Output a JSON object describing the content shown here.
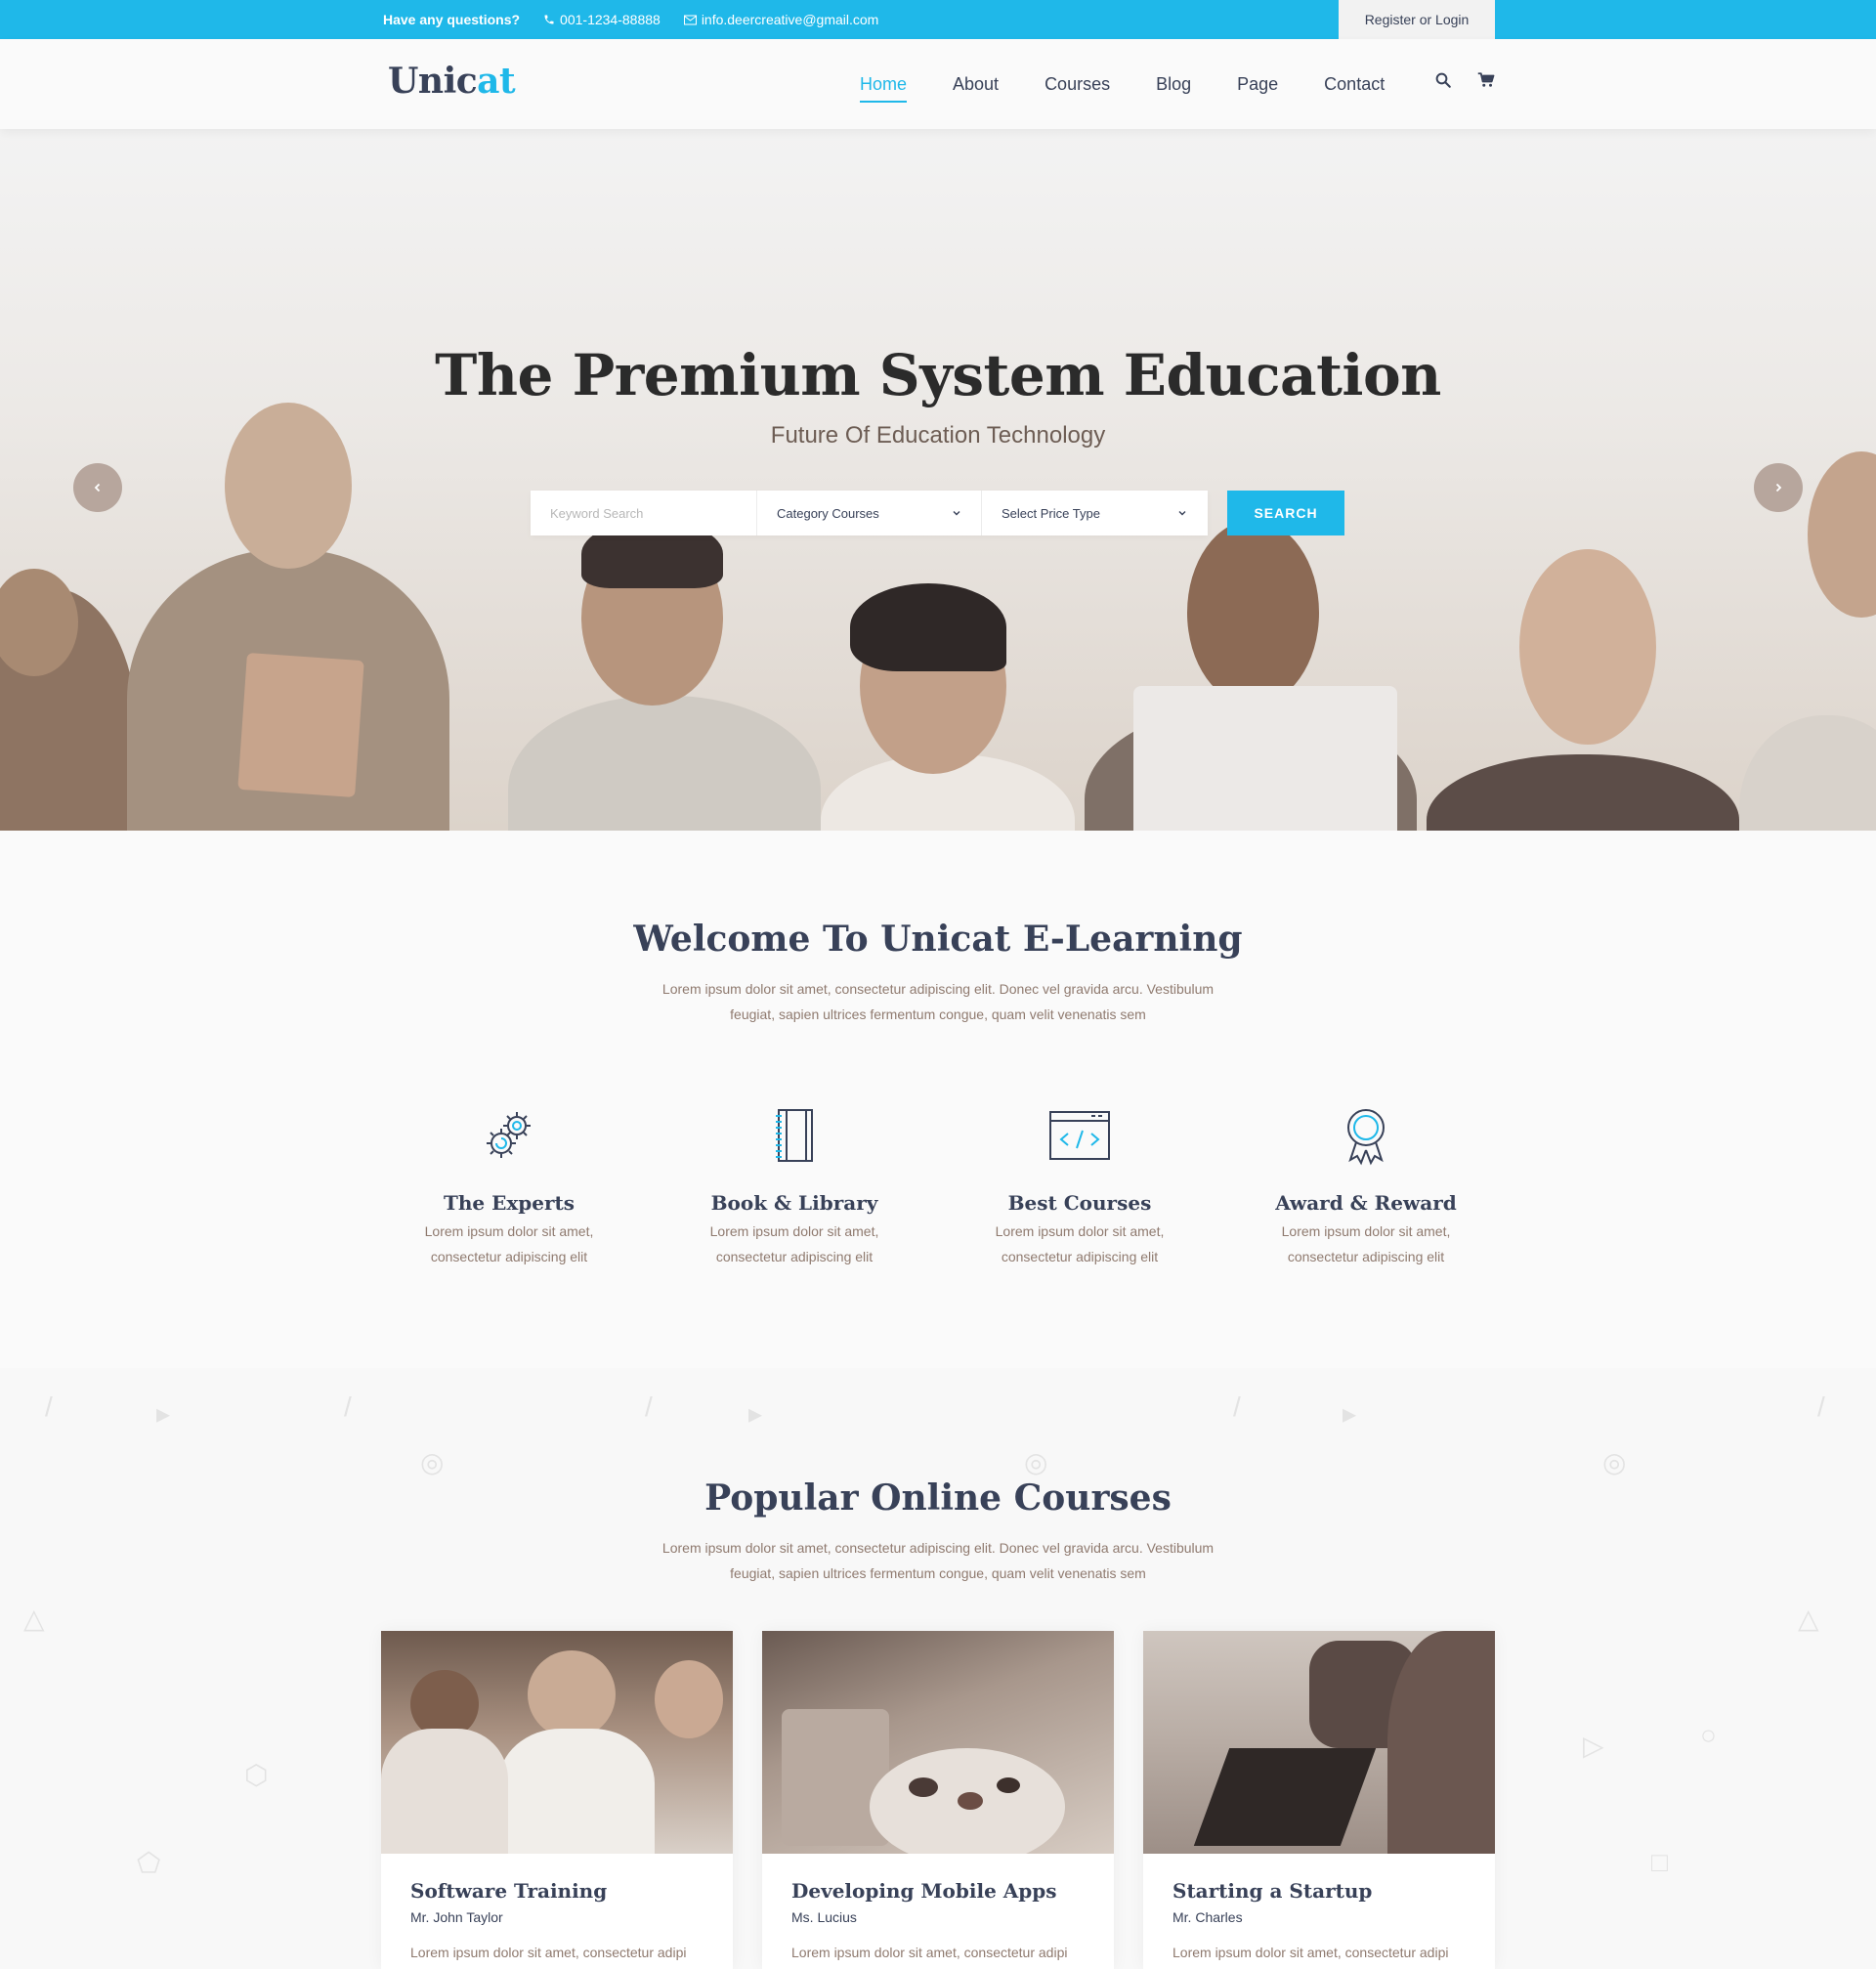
{
  "topbar": {
    "question": "Have any questions?",
    "phone": "001-1234-88888",
    "email": "info.deercreative@gmail.com",
    "login": "Register or Login"
  },
  "header": {
    "logo_main": "Unic",
    "logo_accent": "at",
    "nav": [
      "Home",
      "About",
      "Courses",
      "Blog",
      "Page",
      "Contact"
    ],
    "icons": [
      "search-icon",
      "cart-icon"
    ]
  },
  "hero": {
    "title": "The Premium System Education",
    "subtitle": "Future Of Education Technology",
    "search": {
      "keyword_placeholder": "Keyword Search",
      "category": "Category Courses",
      "price": "Select Price Type",
      "button": "SEARCH"
    }
  },
  "welcome": {
    "title": "Welcome To Unicat E-Learning",
    "text_line1": "Lorem ipsum dolor sit amet, consectetur adipiscing elit. Donec vel gravida arcu. Vestibulum",
    "text_line2": "feugiat, sapien ultrices fermentum congue, quam velit venenatis sem",
    "features": [
      {
        "title": "The Experts",
        "text1": "Lorem ipsum dolor sit amet,",
        "text2": "consectetur adipiscing elit",
        "icon": "gears-icon"
      },
      {
        "title": "Book & Library",
        "text1": "Lorem ipsum dolor sit amet,",
        "text2": "consectetur adipiscing elit",
        "icon": "book-icon"
      },
      {
        "title": "Best Courses",
        "text1": "Lorem ipsum dolor sit amet,",
        "text2": "consectetur adipiscing elit",
        "icon": "code-window-icon"
      },
      {
        "title": "Award & Reward",
        "text1": "Lorem ipsum dolor sit amet,",
        "text2": "consectetur adipiscing elit",
        "icon": "award-icon"
      }
    ]
  },
  "courses": {
    "title": "Popular Online Courses",
    "text_line1": "Lorem ipsum dolor sit amet, consectetur adipiscing elit. Donec vel gravida arcu. Vestibulum",
    "text_line2": "feugiat, sapien ultrices fermentum congue, quam velit venenatis sem",
    "items": [
      {
        "title": "Software Training",
        "author": "Mr. John Taylor",
        "text": "Lorem ipsum dolor sit amet, consectetur adipi"
      },
      {
        "title": "Developing Mobile Apps",
        "author": "Ms. Lucius",
        "text": "Lorem ipsum dolor sit amet, consectetur adipi"
      },
      {
        "title": "Starting a Startup",
        "author": "Mr. Charles",
        "text": "Lorem ipsum dolor sit amet, consectetur adipi"
      }
    ]
  },
  "colors": {
    "accent": "#1fb8e9",
    "text": "#384158",
    "muted": "#8f7a6f"
  }
}
